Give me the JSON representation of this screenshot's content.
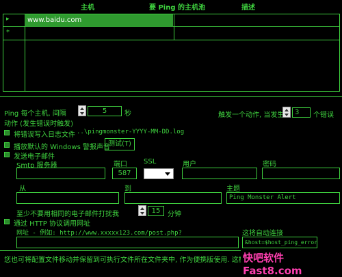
{
  "table": {
    "col_host": "主机",
    "col_title": "要 Ping 的主机池",
    "col_desc": "描述",
    "rows": [
      {
        "marker": "▸",
        "host": "www.baidu.com",
        "desc": ""
      },
      {
        "marker": "*",
        "host": "",
        "desc": ""
      }
    ]
  },
  "ping": {
    "label_prefix": "Ping 每个主机, 间隔",
    "interval": "5",
    "unit": "秒",
    "action_label": "动作 (发生错误时触发)",
    "trigger_label": "触发一个动作, 当发生",
    "error_count": "3",
    "error_unit": "个错误"
  },
  "log": {
    "label": "将错误写入日志文件",
    "path": "..\\pingmonster-YYYY-MM-DD.log"
  },
  "sound": {
    "label": "播放默认的 Windows 警报声音",
    "test_button": "测试(T)"
  },
  "email": {
    "label": "发送电子邮件",
    "smtp_label": "Smtp 服务器",
    "port_label": "端口",
    "port_value": "587",
    "ssl_label": "SSL",
    "user_label": "用户",
    "password_label": "密码",
    "from_label": "从",
    "to_label": "到",
    "subject_label": "主题",
    "subject_value": "Ping Monster Alert",
    "min_interval_label": "至少不要用相同的电子邮件打扰我",
    "min_interval_value": "15",
    "min_unit": "分钟"
  },
  "http": {
    "label": "通过 HTTP 协议调用网址",
    "url_label": "网址 - 例如: http://www.xxxxx123.com/post.php?",
    "autoconnect_label": "这将自动连接",
    "param_value": "&host=$host_ping_error"
  },
  "footer": {
    "text": "您也可将配置文件移动并保留到可执行文件所在文件夹中, 作为便携版使用. 这样, 您",
    "watermark": "快吧软件 Fast8.com"
  },
  "colors": {
    "accent": "#3fd23f",
    "background": "#000000",
    "selection": "#2f9a2f"
  }
}
